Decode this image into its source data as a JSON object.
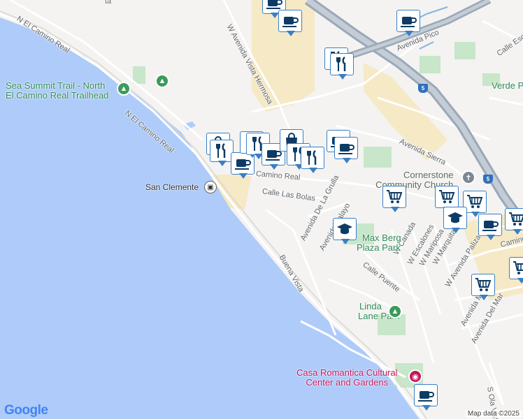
{
  "map": {
    "attribution": "Map data ©2025",
    "logo": "Google",
    "streets": [
      {
        "name": "N El Camino Real",
        "id": "n-el-camino-real-top"
      },
      {
        "name": "N El Camino Real",
        "id": "n-el-camino-real-mid"
      },
      {
        "name": "W Avenida Vista Hermosa",
        "id": "w-avenida-vista-hermosa"
      },
      {
        "name": "Avenida Pico",
        "id": "avenida-pico"
      },
      {
        "name": "Calle Escl",
        "id": "calle-escl"
      },
      {
        "name": "Avenida Sierra",
        "id": "avenida-sierra"
      },
      {
        "name": "Camino Real",
        "id": "camino-real"
      },
      {
        "name": "Calle Las Bolas",
        "id": "calle-las-bolas"
      },
      {
        "name": "Avenida De La Grulla",
        "id": "avenida-de-la-grulla"
      },
      {
        "name": "Avenida Palayo",
        "id": "avenida-palayo"
      },
      {
        "name": "Buena Vista",
        "id": "buena-vista"
      },
      {
        "name": "Calle Puente",
        "id": "calle-puente"
      },
      {
        "name": "W Canada",
        "id": "w-canada"
      },
      {
        "name": "W Escalones",
        "id": "w-escalones"
      },
      {
        "name": "W Mariposa",
        "id": "w-mariposa"
      },
      {
        "name": "W Marquita",
        "id": "w-marquita"
      },
      {
        "name": "W Avenida Palizada",
        "id": "w-avenida-palizada"
      },
      {
        "name": "Avenida Miramar",
        "id": "avenida-miramar"
      },
      {
        "name": "Avenida Del Mar",
        "id": "avenida-del-mar"
      },
      {
        "name": "S Ola Vista",
        "id": "s-ola-vista"
      },
      {
        "name": "Camino Re",
        "id": "camino-re-right"
      }
    ],
    "places": {
      "sea_summit_line1": "Sea Summit Trail - North",
      "sea_summit_line2": "El Camino Real Trailhead",
      "san_clemente": "San Clemente",
      "cornerstone_line1": "Cornerstone",
      "cornerstone_line2": "Community Church",
      "verde_park": "Verde Park",
      "max_berg_line1": "Max Berg",
      "max_berg_line2": "Plaza Park",
      "linda_line1": "Linda",
      "linda_line2": "Lane Park",
      "casa_line1": "Casa Romantica Cultural",
      "casa_line2": "Center and Gardens",
      "tail_text": "ta"
    },
    "highway_shield": "5",
    "markers": [
      {
        "type": "cafe"
      },
      {
        "type": "cafe"
      },
      {
        "type": "cafe"
      },
      {
        "type": "restaurant"
      },
      {
        "type": "restaurant"
      },
      {
        "type": "shopping"
      },
      {
        "type": "restaurant"
      },
      {
        "type": "cafe"
      },
      {
        "type": "shopping"
      },
      {
        "type": "restaurant"
      },
      {
        "type": "cafe"
      },
      {
        "type": "shopping"
      },
      {
        "type": "restaurant"
      },
      {
        "type": "restaurant"
      },
      {
        "type": "cafe"
      },
      {
        "type": "cafe"
      },
      {
        "type": "grocery"
      },
      {
        "type": "grocery"
      },
      {
        "type": "grocery"
      },
      {
        "type": "school"
      },
      {
        "type": "school"
      },
      {
        "type": "cafe"
      },
      {
        "type": "grocery"
      },
      {
        "type": "grocery"
      },
      {
        "type": "grocery"
      },
      {
        "type": "cafe"
      }
    ],
    "colors": {
      "water": "#aecbfa",
      "land": "#f4f3f1",
      "highway": "#9aa8b8",
      "park": "#c8e6c9",
      "commercial": "#f5e9c6",
      "marker_border": "#3a7fc4",
      "marker_icon": "#0d3b66"
    }
  }
}
